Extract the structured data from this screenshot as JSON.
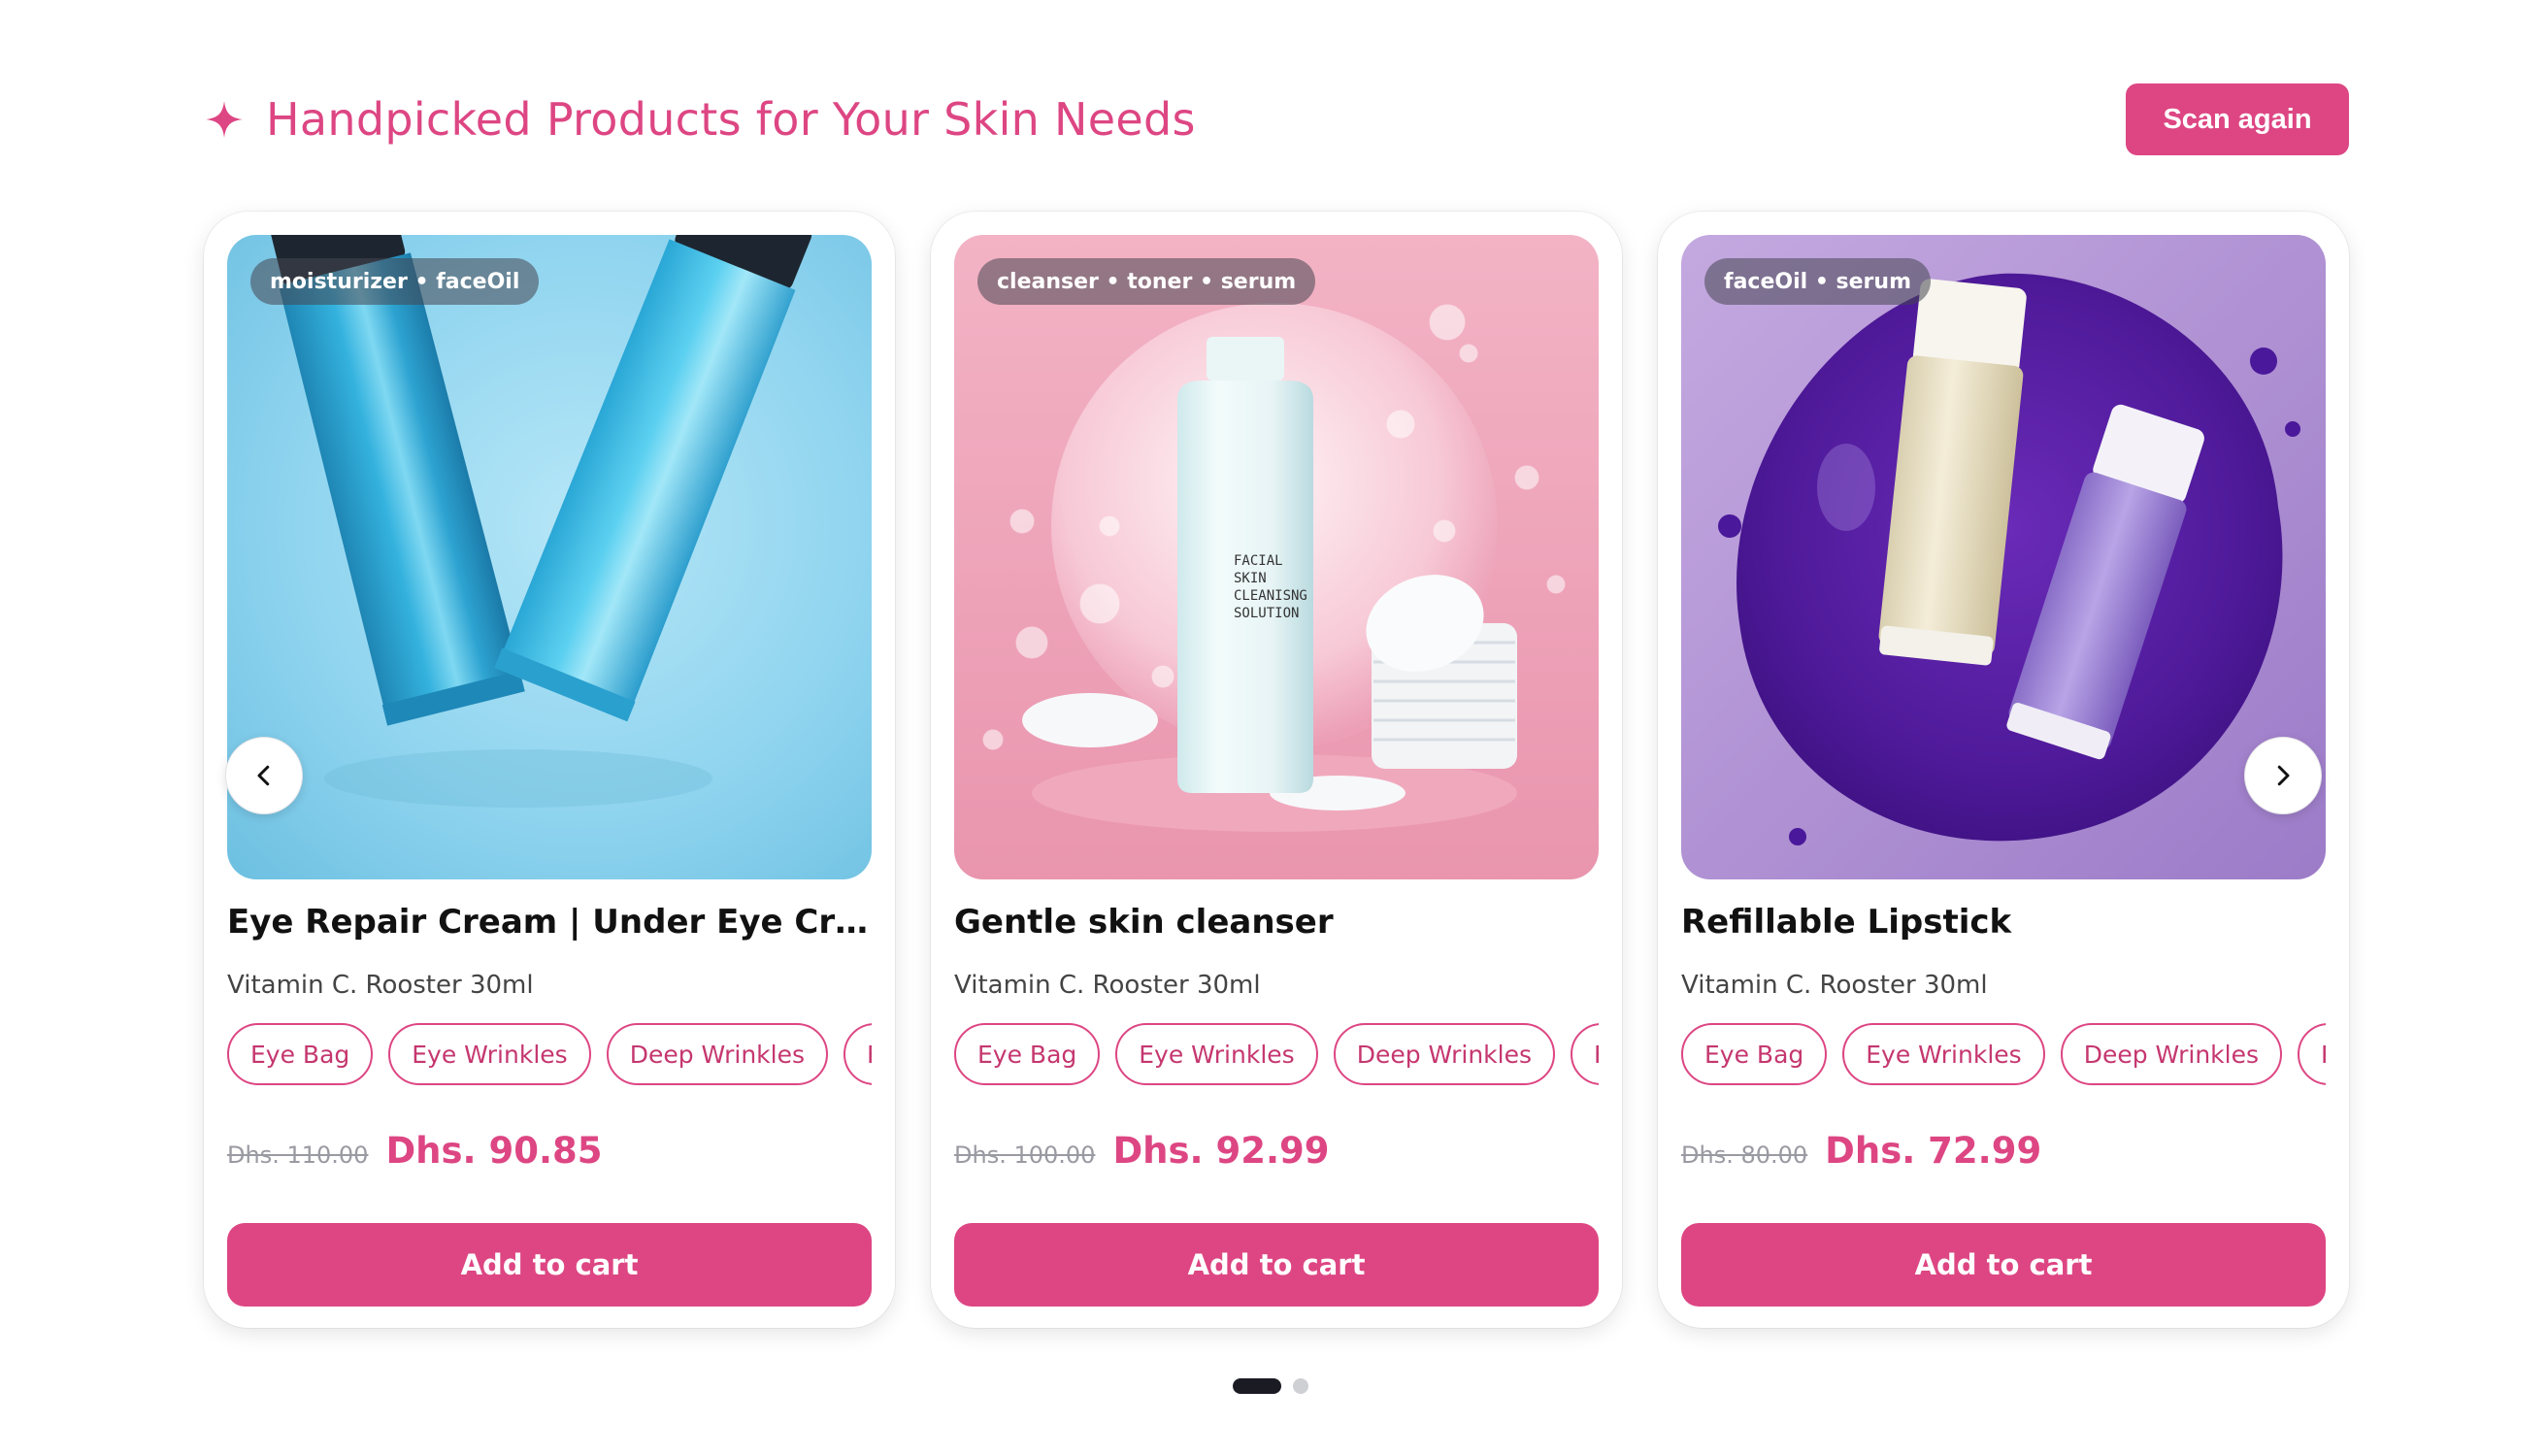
{
  "header": {
    "title": "Handpicked Products for Your Skin Needs",
    "icon": "sparkle-icon",
    "scan_again_label": "Scan again"
  },
  "colors": {
    "accent": "#dd4683",
    "old_price": "#9a9aa2",
    "active_dot": "#1b1b24",
    "inactive_dot": "#cfd0d4"
  },
  "products": [
    {
      "tags": "moisturizer • faceOil",
      "name": "Eye Repair Cream | Under Eye Cream fo...",
      "brand": "Vitamin C. Rooster 30ml",
      "concerns": [
        "Eye Bag",
        "Eye Wrinkles",
        "Deep Wrinkles",
        "Fine"
      ],
      "old_price": "Dhs. 110.00",
      "price": "Dhs. 90.85",
      "cta": "Add to cart"
    },
    {
      "tags": "cleanser • toner • serum",
      "name": "Gentle skin cleanser",
      "brand": "Vitamin C. Rooster 30ml",
      "concerns": [
        "Eye Bag",
        "Eye Wrinkles",
        "Deep Wrinkles",
        "Fine"
      ],
      "old_price": "Dhs. 100.00",
      "price": "Dhs. 92.99",
      "cta": "Add to cart",
      "bottle_label": [
        "FACIAL",
        "SKIN",
        "CLEANISNG",
        "SOLUTION"
      ]
    },
    {
      "tags": "faceOil • serum",
      "name": "Refillable Lipstick",
      "brand": "Vitamin C. Rooster 30ml",
      "concerns": [
        "Eye Bag",
        "Eye Wrinkles",
        "Deep Wrinkles",
        "Fine"
      ],
      "old_price": "Dhs. 80.00",
      "price": "Dhs. 72.99",
      "cta": "Add to cart"
    }
  ],
  "carousel": {
    "prev_icon": "chevron-left-icon",
    "next_icon": "chevron-right-icon",
    "pages": 2,
    "active_page": 1
  }
}
